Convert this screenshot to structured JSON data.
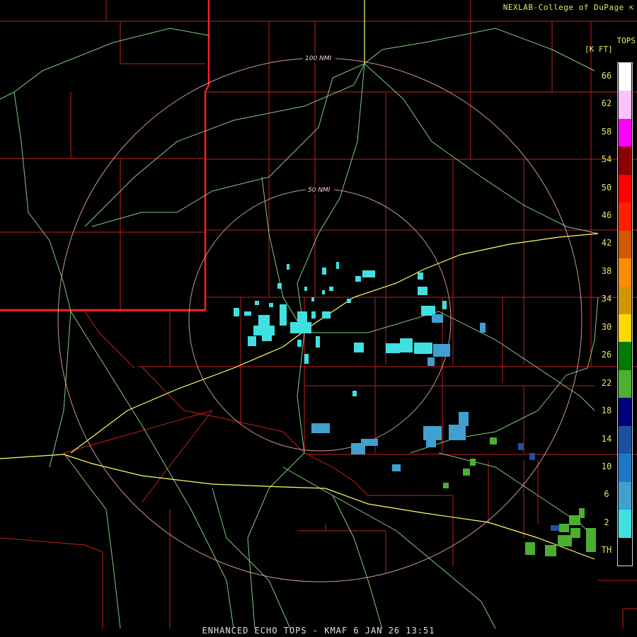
{
  "credit": "NEXLAB-College of DuPage",
  "product_title": "ENHANCED ECHO TOPS - KMAF 6 JAN 26 13:51",
  "legend": {
    "title_line1": "TOPS",
    "title_line2": "[K FT]",
    "labels": [
      "66",
      "62",
      "58",
      "54",
      "50",
      "46",
      "42",
      "38",
      "34",
      "30",
      "26",
      "22",
      "18",
      "14",
      "10",
      "6",
      "2",
      "TH"
    ],
    "colors": [
      "#ffffff",
      "#ffc0ff",
      "#ff00ff",
      "#8b0000",
      "#ff0000",
      "#ff2000",
      "#d05800",
      "#ff8c00",
      "#d49600",
      "#ffd700",
      "#007a00",
      "#4caf30",
      "#00007a",
      "#1e50a0",
      "#1e78c8",
      "#40a0d0",
      "#40e0e0",
      "#000000"
    ]
  },
  "range_rings": [
    {
      "label": "100 NMI",
      "nmi": 100
    },
    {
      "label": "50 NMI",
      "nmi": 50
    }
  ],
  "colors": {
    "county_lines": "#c02020",
    "state_line": "#ff2020",
    "roads": "#90e090",
    "highways": "#ffff60",
    "rings": "#f0b0b0"
  }
}
